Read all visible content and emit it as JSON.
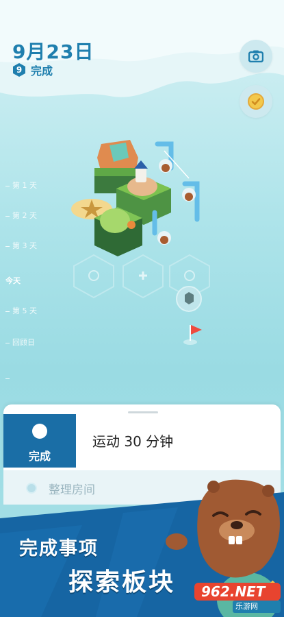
{
  "header": {
    "date": "9月23日",
    "done_count": "9",
    "done_label": "完成"
  },
  "buttons": {
    "camera": "camera-icon",
    "achievement": "check-badge-icon"
  },
  "timeline": {
    "days": [
      "第 1 天",
      "第 2 天",
      "第 3 天",
      "今天",
      "第 5 天",
      "回顾日"
    ]
  },
  "task_card": {
    "done_button_label": "完成",
    "current_task": "运动 30 分钟",
    "next_task": "整理房间"
  },
  "promo": {
    "line1": "完成事项",
    "line2": "探索板块"
  },
  "watermark": {
    "text": "962.NET",
    "sub": "乐游网"
  },
  "colors": {
    "primary": "#1a6ea6",
    "date_text": "#1f7fae",
    "banner": "#1665a3"
  }
}
